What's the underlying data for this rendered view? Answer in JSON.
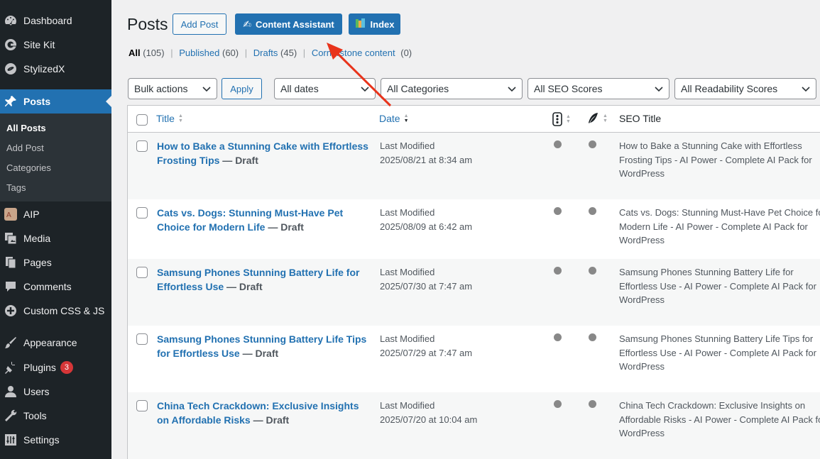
{
  "sidebar": {
    "items": [
      {
        "label": "Dashboard",
        "icon": "dashboard-icon"
      },
      {
        "label": "Site Kit",
        "icon": "sitekit-icon"
      },
      {
        "label": "StylizedX",
        "icon": "stylizedx-icon"
      },
      {
        "label": "Posts",
        "icon": "pin-icon"
      },
      {
        "label": "AIP",
        "icon": "aip-icon"
      },
      {
        "label": "Media",
        "icon": "media-icon"
      },
      {
        "label": "Pages",
        "icon": "pages-icon"
      },
      {
        "label": "Comments",
        "icon": "comments-icon"
      },
      {
        "label": "Custom CSS & JS",
        "icon": "plus-circle-icon"
      },
      {
        "label": "Appearance",
        "icon": "brush-icon"
      },
      {
        "label": "Plugins",
        "icon": "plugin-icon",
        "badge": "3"
      },
      {
        "label": "Users",
        "icon": "user-icon"
      },
      {
        "label": "Tools",
        "icon": "wrench-icon"
      },
      {
        "label": "Settings",
        "icon": "settings-icon"
      }
    ],
    "submenu": [
      "All Posts",
      "Add Post",
      "Categories",
      "Tags"
    ]
  },
  "header": {
    "title": "Posts",
    "add_post": "Add Post",
    "content_assistant": "Content Assistant",
    "index": "Index"
  },
  "views": {
    "all": "All",
    "all_count": "(105)",
    "published": "Published",
    "published_count": "(60)",
    "drafts": "Drafts",
    "drafts_count": "(45)",
    "cornerstone": "Cornerstone content",
    "cornerstone_count": "(0)",
    "sep": "|"
  },
  "filters": {
    "bulk": "Bulk actions",
    "apply": "Apply",
    "dates": "All dates",
    "categories": "All Categories",
    "seo": "All SEO Scores",
    "readability": "All Readability Scores"
  },
  "table": {
    "columns": {
      "title": "Title",
      "date": "Date",
      "seo_title": "SEO Title"
    },
    "rows": [
      {
        "title": "How to Bake a Stunning Cake with Effortless Frosting Tips",
        "state": " — Draft",
        "date_label": "Last Modified",
        "date": "2025/08/21 at 8:34 am",
        "seo_title": "How to Bake a Stunning Cake with Effortless Frosting Tips - AI Power - Complete AI Pack for WordPress"
      },
      {
        "title": "Cats vs. Dogs: Stunning Must-Have Pet Choice for Modern Life",
        "state": " — Draft",
        "date_label": "Last Modified",
        "date": "2025/08/09 at 6:42 am",
        "seo_title": "Cats vs. Dogs: Stunning Must-Have Pet Choice for Modern Life - AI Power - Complete AI Pack for WordPress"
      },
      {
        "title": "Samsung Phones Stunning Battery Life for Effortless Use",
        "state": " — Draft",
        "date_label": "Last Modified",
        "date": "2025/07/30 at 7:47 am",
        "seo_title": "Samsung Phones Stunning Battery Life for Effortless Use - AI Power - Complete AI Pack for WordPress"
      },
      {
        "title": "Samsung Phones Stunning Battery Life Tips for Effortless Use",
        "state": " — Draft",
        "date_label": "Last Modified",
        "date": "2025/07/29 at 7:47 am",
        "seo_title": "Samsung Phones Stunning Battery Life Tips for Effortless Use - AI Power - Complete AI Pack for WordPress"
      },
      {
        "title": "China Tech Crackdown: Exclusive Insights on Affordable Risks",
        "state": " — Draft",
        "date_label": "Last Modified",
        "date": "2025/07/20 at 10:04 am",
        "seo_title": "China Tech Crackdown: Exclusive Insights on Affordable Risks - AI Power - Complete AI Pack for WordPress"
      }
    ]
  },
  "colors": {
    "accent": "#2271b1",
    "sidebar_bg": "#1d2327",
    "arrow": "#e8341c"
  }
}
